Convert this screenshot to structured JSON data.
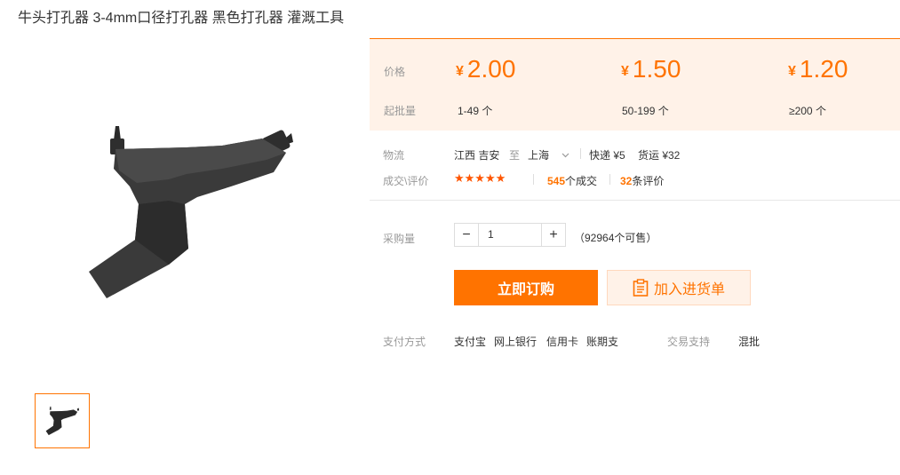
{
  "product": {
    "title": "牛头打孔器 3-4mm口径打孔器 黑色打孔器 灌溉工具"
  },
  "gallery": {
    "main_image": "black-t-shaped-hole-punch-tool",
    "thumbnail": "black-t-shaped-hole-punch-tool"
  },
  "price_panel": {
    "price_label": "价格",
    "moq_label": "起批量",
    "currency": "¥",
    "tiers": [
      {
        "price": "2.00",
        "range": "1-49 个"
      },
      {
        "price": "1.50",
        "range": "50-199 个"
      },
      {
        "price": "1.20",
        "range": "≥200 个"
      }
    ],
    "accent_color": "#ff7300",
    "bg_color": "#fff2e8"
  },
  "logistics": {
    "label": "物流",
    "from": "江西 吉安",
    "to_word": "至",
    "destination": "上海",
    "express": "快递 ¥5",
    "freight": "货运 ¥32"
  },
  "reviews": {
    "label": "成交\\评价",
    "stars": "★★★★★",
    "deals_count": "545",
    "deals_text": "个成交",
    "review_count": "32",
    "review_text": "条评价"
  },
  "purchase": {
    "label": "采购量",
    "minus": "−",
    "plus": "+",
    "quantity": "1",
    "available": "（92964个可售）",
    "buy_label": "立即订购",
    "cart_label": "加入进货单"
  },
  "payment": {
    "label": "支付方式",
    "methods": [
      "支付宝",
      "网上银行",
      "信用卡",
      "账期支"
    ],
    "support_label": "交易支持",
    "support_value": "混批"
  }
}
